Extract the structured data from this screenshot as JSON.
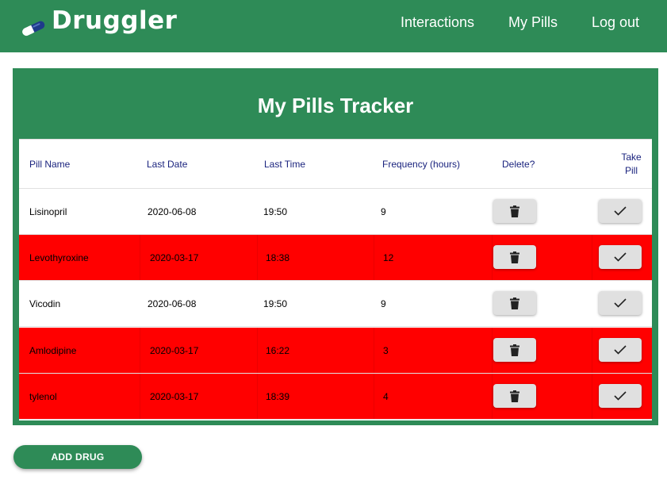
{
  "brand": {
    "name": "Druggler",
    "logo_icon": "pill-capsule-icon"
  },
  "nav": {
    "links": [
      {
        "label": "Interactions"
      },
      {
        "label": "My Pills"
      },
      {
        "label": "Log out"
      }
    ]
  },
  "tracker": {
    "title": "My Pills Tracker",
    "headers": {
      "pill_name": "Pill Name",
      "last_date": "Last Date",
      "last_time": "Last Time",
      "frequency": "Frequency (hours)",
      "delete": "Delete?",
      "take_line1": "Take",
      "take_line2": "Pill"
    },
    "rows": [
      {
        "name": "Lisinopril",
        "date": "2020-06-08",
        "time": "19:50",
        "frequency": "9",
        "overdue": false
      },
      {
        "name": "Levothyroxine",
        "date": "2020-03-17",
        "time": "18:38",
        "frequency": "12",
        "overdue": true
      },
      {
        "name": "Vicodin",
        "date": "2020-06-08",
        "time": "19:50",
        "frequency": "9",
        "overdue": false
      },
      {
        "name": "Amlodipine",
        "date": "2020-03-17",
        "time": "16:22",
        "frequency": "3",
        "overdue": true
      },
      {
        "name": "tylenol",
        "date": "2020-03-17",
        "time": "18:39",
        "frequency": "4",
        "overdue": true
      }
    ],
    "icons": {
      "delete": "trash-icon",
      "take": "checkmark-icon"
    }
  },
  "actions": {
    "add_drug_label": "ADD DRUG"
  },
  "colors": {
    "primary": "#2e8b57",
    "overdue_row": "#ff0000",
    "header_text": "#1a237e",
    "button_bg": "#e0e0e0"
  }
}
